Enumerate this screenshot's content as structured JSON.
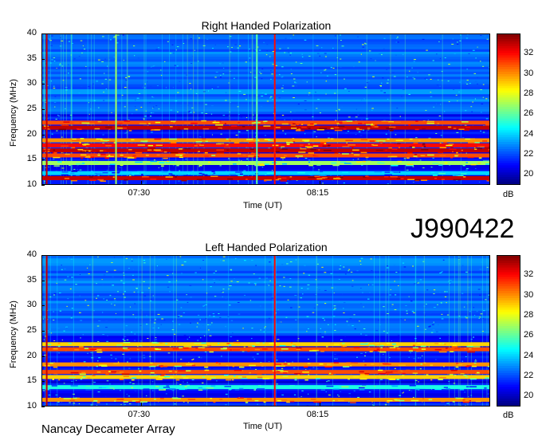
{
  "page_title": "J990422",
  "footer": "Nancay Decameter Array",
  "chart_data": [
    {
      "type": "heatmap",
      "title": "Right Handed Polarization",
      "xlabel": "Time (UT)",
      "ylabel": "Frequency (MHz)",
      "ylim": [
        10,
        40
      ],
      "yticks": [
        "10",
        "15",
        "20",
        "25",
        "30",
        "35",
        "40"
      ],
      "xticks": [
        "07:30",
        "08:15"
      ],
      "colorbar": {
        "label": "dB",
        "range": [
          19,
          34
        ],
        "ticks": [
          "20",
          "22",
          "24",
          "26",
          "28",
          "30",
          "32"
        ],
        "colormap": "jet"
      },
      "bands": [
        {
          "freq": 22.5,
          "db": 31
        },
        {
          "freq": 21.5,
          "db": 33
        },
        {
          "freq": 19,
          "db": 30
        },
        {
          "freq": 18,
          "db": 32
        },
        {
          "freq": 17,
          "db": 33
        },
        {
          "freq": 16,
          "db": 31
        },
        {
          "freq": 14.5,
          "db": 27
        },
        {
          "freq": 12.5,
          "db": 24
        },
        {
          "freq": 11.5,
          "db": 33
        }
      ],
      "vertical_lines": [
        {
          "time_frac": 0.01,
          "db": 33
        },
        {
          "time_frac": 0.165,
          "db": 27
        },
        {
          "time_frac": 0.48,
          "db": 26
        },
        {
          "time_frac": 0.52,
          "db": 32
        }
      ]
    },
    {
      "type": "heatmap",
      "title": "Left Handed Polarization",
      "xlabel": "Time (UT)",
      "ylabel": "Frequency (MHz)",
      "ylim": [
        10,
        40
      ],
      "yticks": [
        "10",
        "15",
        "20",
        "25",
        "30",
        "35",
        "40"
      ],
      "xticks": [
        "07:30",
        "08:15"
      ],
      "colorbar": {
        "label": "dB",
        "range": [
          19,
          34
        ],
        "ticks": [
          "20",
          "22",
          "24",
          "26",
          "28",
          "30",
          "32"
        ],
        "colormap": "jet"
      },
      "bands": [
        {
          "freq": 22.5,
          "db": 29
        },
        {
          "freq": 21.5,
          "db": 31
        },
        {
          "freq": 18.5,
          "db": 30
        },
        {
          "freq": 17,
          "db": 31
        },
        {
          "freq": 16,
          "db": 29
        },
        {
          "freq": 14,
          "db": 25
        },
        {
          "freq": 11.5,
          "db": 30
        }
      ],
      "vertical_lines": [
        {
          "time_frac": 0.01,
          "db": 33
        },
        {
          "time_frac": 0.52,
          "db": 32
        }
      ]
    }
  ]
}
